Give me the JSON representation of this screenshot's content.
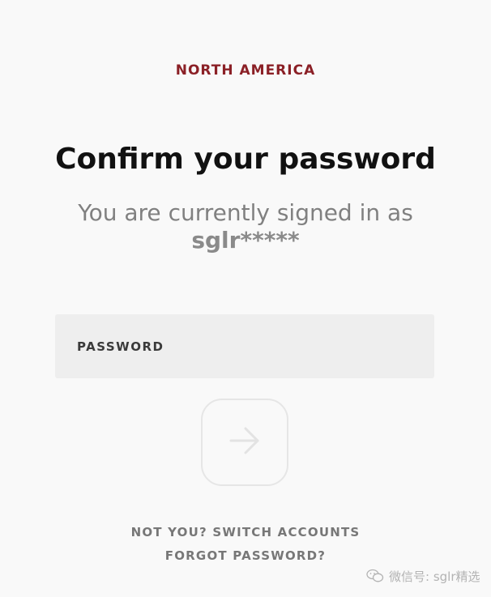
{
  "header": {
    "region": "NORTH AMERICA"
  },
  "main": {
    "title": "Confirm your password",
    "subtitle": "You are currently signed in as",
    "username": "sglr*****"
  },
  "form": {
    "password_label": "PASSWORD",
    "password_value": "",
    "submit_icon": "arrow-right-icon"
  },
  "links": {
    "switch_accounts": "NOT YOU? SWITCH ACCOUNTS",
    "forgot_password": "FORGOT PASSWORD?"
  },
  "watermark": {
    "text": "微信号: sglr精选",
    "icon": "wechat-icon"
  },
  "colors": {
    "background": "#f9f9f9",
    "accent": "#8b2026",
    "title": "#111111",
    "muted": "#808080",
    "field_bg": "#eeeeee"
  }
}
